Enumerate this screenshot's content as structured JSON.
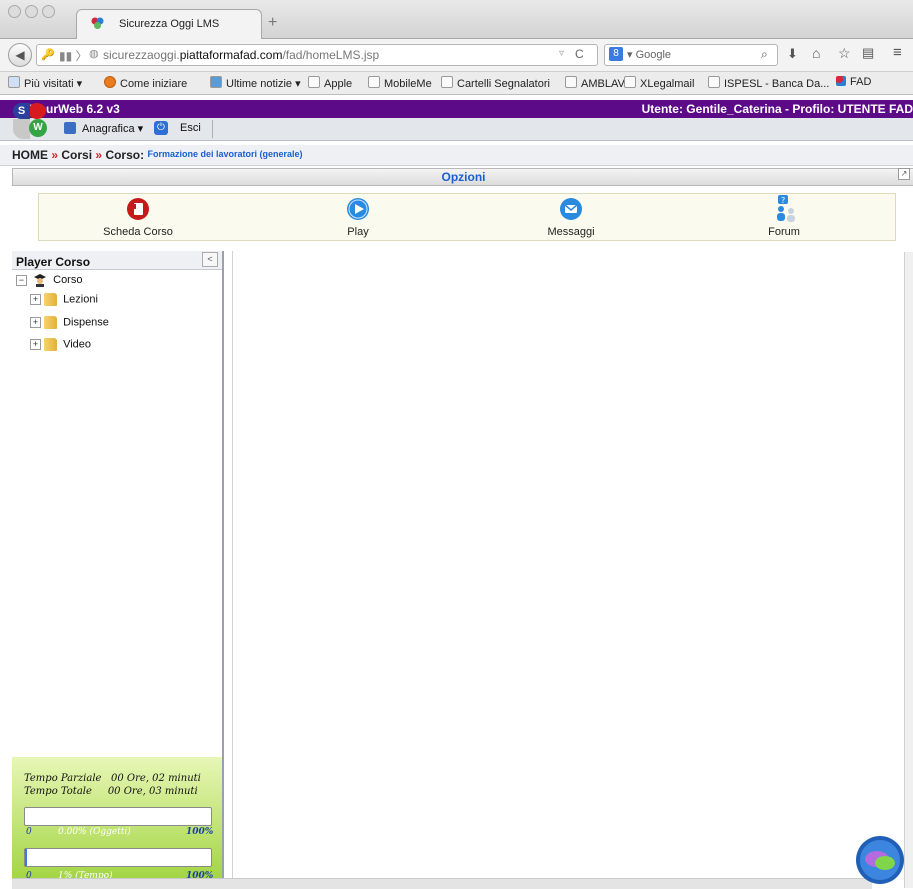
{
  "browser": {
    "tab_title": "Sicurezza Oggi LMS",
    "new_tab": "+",
    "url_prefix": "sicurezzaoggi.",
    "url_domain": "piattaformafad.com",
    "url_path": "/fad/homeLMS.jsp",
    "search_placeholder": "Google",
    "search_engine_glyph": "8"
  },
  "bookmarks": [
    {
      "label": "Più visitati ▾"
    },
    {
      "label": "Come iniziare"
    },
    {
      "label": "Ultime notizie ▾"
    },
    {
      "label": "Apple"
    },
    {
      "label": "MobileMe"
    },
    {
      "label": "Cartelli Segnalatori"
    },
    {
      "label": "AMBLAV"
    },
    {
      "label": "XLegalmail"
    },
    {
      "label": "ISPESL - Banca Da..."
    },
    {
      "label": "FAD"
    }
  ],
  "app": {
    "title": "SicurWeb 6.2 v3",
    "user_info": "Utente: Gentile_Caterina - Profilo: UTENTE FAD",
    "logo_letters": {
      "s": "S",
      "w": "W"
    },
    "toolbar": {
      "anagrafica": "Anagrafica ▾",
      "esci": "Esci"
    }
  },
  "breadcrumb": {
    "home": "HOME",
    "sep": "»",
    "corsi": "Corsi",
    "corso_label": "Corso:",
    "corso_name": "Formazione dei lavoratori (generale)"
  },
  "options": {
    "title": "Opzioni",
    "items": [
      {
        "label": "Scheda Corso",
        "icon": "course-card-icon"
      },
      {
        "label": "Play",
        "icon": "play-icon"
      },
      {
        "label": "Messaggi",
        "icon": "mail-icon"
      },
      {
        "label": "Forum",
        "icon": "forum-icon"
      }
    ]
  },
  "player": {
    "title": "Player Corso",
    "collapse": "<",
    "tree_root": "Corso",
    "tree_items": [
      {
        "label": "Lezioni"
      },
      {
        "label": "Dispense"
      },
      {
        "label": "Video"
      }
    ]
  },
  "time": {
    "parziale_label": "Tempo Parziale",
    "parziale_value": "00 Ore, 02 minuti",
    "totale_label": "Tempo Totale",
    "totale_value": "00 Ore, 03 minuti",
    "bar1": {
      "min": "0",
      "text": "0.00% (Oggetti)",
      "max": "100%",
      "fraction": 0.0
    },
    "bar2": {
      "min": "0",
      "text": "1% (Tempo)",
      "max": "100%",
      "fraction": 0.01
    }
  },
  "colors": {
    "header_bg": "#5c0a87",
    "accent_link": "#1a5fd0",
    "green_panel": "#9fd33d"
  }
}
